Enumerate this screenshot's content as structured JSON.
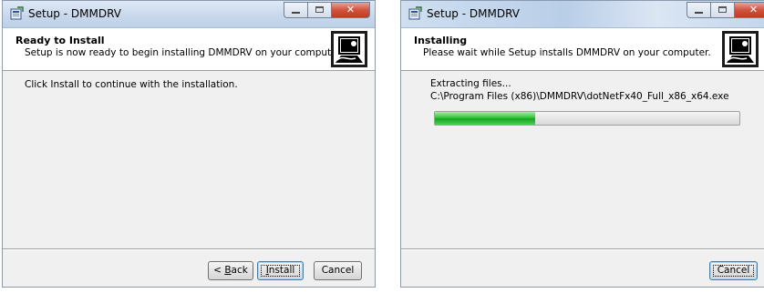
{
  "windows": [
    {
      "title": "Setup - DMMDRV",
      "header": {
        "title": "Ready to Install",
        "subtitle": "Setup is now ready to begin installing DMMDRV on your computer."
      },
      "body_text": "Click Install to continue with the installation.",
      "buttons": {
        "back": {
          "mnemonic": "B",
          "rest": "ack",
          "prefix": "< "
        },
        "install": {
          "mnemonic": "I",
          "rest": "nstall"
        },
        "cancel": "Cancel"
      }
    },
    {
      "title": "Setup - DMMDRV",
      "header": {
        "title": "Installing",
        "subtitle": "Please wait while Setup installs DMMDRV on your computer."
      },
      "status_text": "Extracting files...",
      "path_text": "C:\\Program Files (x86)\\DMMDRV\\dotNetFx40_Full_x86_x64.exe",
      "progress": 0.33,
      "buttons": {
        "cancel": "Cancel"
      }
    }
  ],
  "icons": {
    "app": "setup-app-icon",
    "header_graphic": "installer-computer-graphic",
    "minimize": "minimize-icon",
    "maximize": "maximize-icon",
    "close": "close-icon"
  },
  "colors": {
    "titlebar": "#c9d9ec",
    "close_button": "#c13a24",
    "progress_fill": "#16a51f",
    "dialog_bg": "#f0f0f0"
  }
}
